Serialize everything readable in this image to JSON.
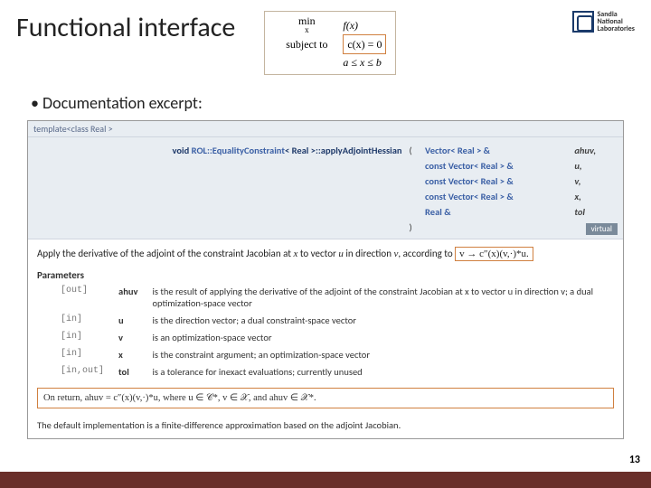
{
  "title": "Functional interface",
  "formula": {
    "min_label": "min",
    "min_sub": "x",
    "objective": "f(x)",
    "subject_label": "subject to",
    "constraint": "c(x) = 0",
    "bounds": "a ≤ x ≤ b"
  },
  "logo": {
    "line1": "Sandia",
    "line2": "National",
    "line3": "Laboratories"
  },
  "bullet": "Documentation excerpt:",
  "doc": {
    "template_header": "template<class Real >",
    "sig": {
      "return_prefix": "void ",
      "class_link": "ROL::EqualityConstraint",
      "class_tpl": "< Real >::applyAdjointHessian",
      "paren_open": "(",
      "params": [
        {
          "type": "Vector< Real > &",
          "name": "ahuv,"
        },
        {
          "type": "const Vector< Real > &",
          "name": "u,"
        },
        {
          "type": "const Vector< Real > &",
          "name": "v,"
        },
        {
          "type": "const Vector< Real > &",
          "name": "x,"
        },
        {
          "type": "Real &",
          "name": "tol"
        }
      ],
      "paren_close": ")",
      "virtual_badge": "virtual"
    },
    "desc_prefix": "Apply the derivative of the adjoint of the constraint Jacobian at ",
    "desc_x": "x",
    "desc_mid1": " to vector ",
    "desc_u": "u",
    "desc_mid2": " in direction ",
    "desc_v": "v",
    "desc_suffix": ", according to ",
    "map_box": "v → c″(x)(v,·)*u.",
    "params_header": "Parameters",
    "params": [
      {
        "dir": "[out]",
        "name": "ahuv",
        "desc": "is the result of applying the derivative of the adjoint of the constraint Jacobian at x to vector u in direction v; a dual optimization-space vector"
      },
      {
        "dir": "[in]",
        "name": "u",
        "desc": "is the direction vector; a dual constraint-space vector"
      },
      {
        "dir": "[in]",
        "name": "v",
        "desc": "is an optimization-space vector"
      },
      {
        "dir": "[in]",
        "name": "x",
        "desc": "is the constraint argument; an optimization-space vector"
      },
      {
        "dir": "[in,out]",
        "name": "tol",
        "desc": "is a tolerance for inexact evaluations; currently unused"
      }
    ],
    "return_line": "On return, ahuv = c″(x)(v,·)*u, where u ∈ 𝒞*, v ∈ 𝒳, and ahuv ∈ 𝒳*.",
    "default_impl": "The default implementation is a finite-difference approximation based on the adjoint Jacobian."
  },
  "page_number": "13"
}
